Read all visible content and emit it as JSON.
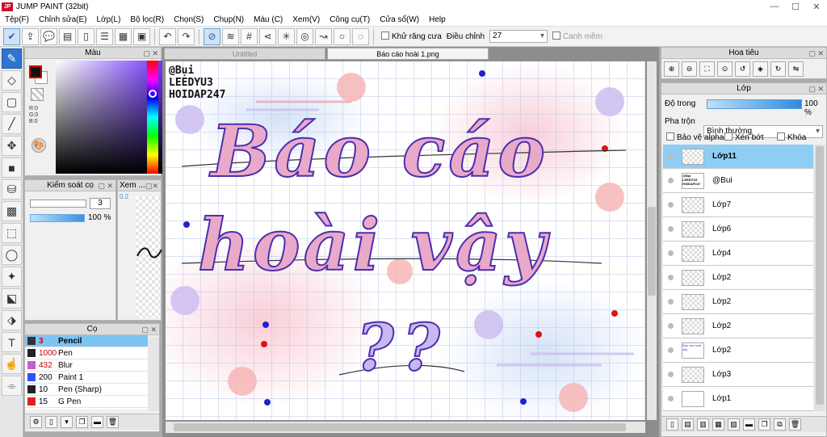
{
  "app": {
    "title": "JUMP PAINT (32bit)"
  },
  "menu": [
    "Tệp(F)",
    "Chỉnh sửa(E)",
    "Lớp(L)",
    "Bộ lọc(R)",
    "Chọn(S)",
    "Chụp(N)",
    "Màu (C)",
    "Xem(V)",
    "Công cụ(T)",
    "Cửa sổ(W)",
    "Help"
  ],
  "toolbar": {
    "antialias_label": "Khử răng cưa",
    "correction_label": "Điều chỉnh",
    "correction_value": "27",
    "snap_label": "Canh mềm"
  },
  "color_panel": {
    "title": "Màu",
    "r": "R:0",
    "g": "G:0",
    "b": "B:0"
  },
  "brush_control": {
    "title": "Kiểm soát cọ",
    "size": "3",
    "opacity": "100 %"
  },
  "preview": {
    "title": "Xem ...",
    "value": "0.2"
  },
  "brush_panel": {
    "title": "Cọ",
    "items": [
      {
        "size": "3",
        "name": "Pencil",
        "color": "#333333",
        "selected": true
      },
      {
        "size": "1000",
        "name": "Pen",
        "color": "#222222"
      },
      {
        "size": "432",
        "name": "Blur",
        "color": "#c060d0"
      },
      {
        "size": "200",
        "name": "Paint 1",
        "color": "#3050ff"
      },
      {
        "size": "10",
        "name": "Pen (Sharp)",
        "color": "#222222"
      },
      {
        "size": "15",
        "name": "G Pen",
        "color": "#e02020"
      }
    ]
  },
  "canvas": {
    "tabs": [
      "Untitled",
      "Báo cáo hoài 1.png"
    ],
    "credit": [
      "@Bụi",
      "LEEDYU3",
      "HOIDAP247"
    ],
    "line1": "Báo cáo",
    "line2": "hoài vậy",
    "line3": "??"
  },
  "navigator": {
    "title": "Hoa tiêu"
  },
  "layers": {
    "title": "Lớp",
    "opacity_label": "Độ trong",
    "opacity_value": "100 %",
    "blend_label": "Pha trộn",
    "blend_value": "Bình thường",
    "protect_alpha": "Bảo vệ alpha",
    "clip": "Xén bớt",
    "lock": "Khóa",
    "items": [
      {
        "name": "Lớp11",
        "selected": true
      },
      {
        "name": "@Bui",
        "thumb_text": "@Bụi LEEDYU3 HOIDAP247"
      },
      {
        "name": "Lớp7"
      },
      {
        "name": "Lớp6"
      },
      {
        "name": "Lớp4"
      },
      {
        "name": "Lớp2"
      },
      {
        "name": "Lớp2"
      },
      {
        "name": "Lớp2"
      },
      {
        "name": "Lớp2",
        "thumb_text": "Báo cáo hoài vậy"
      },
      {
        "name": "Lớp3"
      },
      {
        "name": "Lớp1"
      }
    ]
  },
  "colors": {
    "accent": "#2f74d0",
    "selection": "#8ecdf4",
    "purple": "#6c4bd6",
    "pink": "#f6b8c6"
  }
}
